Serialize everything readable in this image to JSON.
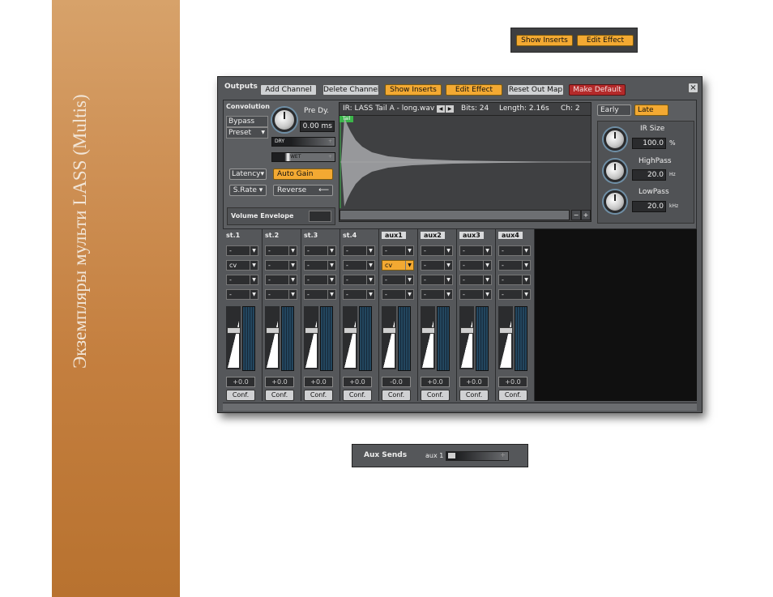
{
  "sidebar": {
    "title": "Экземпляры мульти LASS (Multis)"
  },
  "inserts_strip": {
    "show_inserts": "Show Inserts",
    "edit_effect": "Edit Effect"
  },
  "toolbar": {
    "title": "Outputs",
    "add_channel": "Add Channel",
    "delete_channel": "Delete Channel",
    "show_inserts": "Show Inserts",
    "edit_effect": "Edit Effect",
    "reset_out_map": "Reset Out Map",
    "make_default": "Make Default",
    "close_symbol": "×"
  },
  "convolution": {
    "title": "Convolution",
    "bypass": "Bypass",
    "preset": "Preset",
    "predly_label": "Pre Dy.",
    "predly_value": "0.00 ms",
    "dry": "DRY",
    "wet": "WET",
    "latency": "Latency",
    "auto_gain": "Auto Gain",
    "srate": "S.Rate",
    "reverse": "Reverse",
    "volume_envelope": "Volume Envelope"
  },
  "ir": {
    "name": "IR: LASS Tail A - long.wav",
    "bits": "Bits: 24",
    "length": "Length: 2.16s",
    "channels": "Ch: 2",
    "marker": "Tail",
    "zoom_minus": "−",
    "zoom_plus": "+"
  },
  "reverb": {
    "early": "Early",
    "late": "Late",
    "ir_size_label": "IR Size",
    "ir_size_value": "100.0",
    "ir_size_unit": "%",
    "highpass_label": "HighPass",
    "highpass_value": "20.0",
    "highpass_unit": "Hz",
    "lowpass_label": "LowPass",
    "lowpass_value": "20.0",
    "lowpass_unit": "kHz"
  },
  "channels": [
    {
      "name": "st.1",
      "slots": [
        "-",
        "cv",
        "-",
        "-"
      ],
      "volume": "+0.0",
      "conf": "Conf."
    },
    {
      "name": "st.2",
      "slots": [
        "-",
        "-",
        "-",
        "-"
      ],
      "volume": "+0.0",
      "conf": "Conf."
    },
    {
      "name": "st.3",
      "slots": [
        "-",
        "-",
        "-",
        "-"
      ],
      "volume": "+0.0",
      "conf": "Conf."
    },
    {
      "name": "st.4",
      "slots": [
        "-",
        "-",
        "-",
        "-"
      ],
      "volume": "+0.0",
      "conf": "Conf."
    },
    {
      "name": "aux1",
      "slots": [
        "-",
        "cv",
        "-",
        "-"
      ],
      "volume": "-0.0",
      "conf": "Conf."
    },
    {
      "name": "aux2",
      "slots": [
        "-",
        "-",
        "-",
        "-"
      ],
      "volume": "+0.0",
      "conf": "Conf."
    },
    {
      "name": "aux3",
      "slots": [
        "-",
        "-",
        "-",
        "-"
      ],
      "volume": "+0.0",
      "conf": "Conf."
    },
    {
      "name": "aux4",
      "slots": [
        "-",
        "-",
        "-",
        "-"
      ],
      "volume": "+0.0",
      "conf": "Conf."
    }
  ],
  "aux_sends": {
    "title": "Aux Sends",
    "aux": "aux 1"
  },
  "colors": {
    "accent": "#f3a932",
    "panel": "#55575a",
    "danger": "#b42a2a",
    "sidebar": "#c47f3f"
  }
}
